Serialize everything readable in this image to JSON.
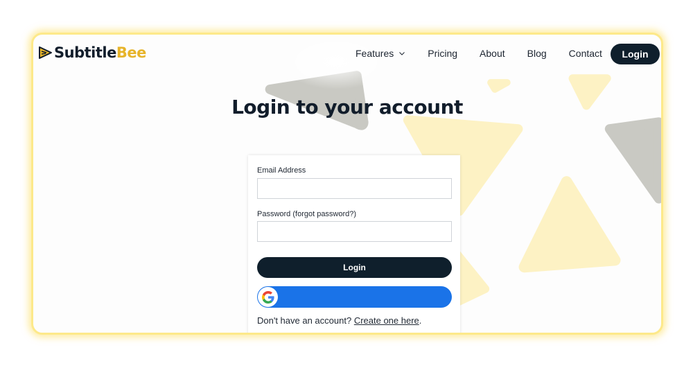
{
  "brand": {
    "name_part1": "Subtitle",
    "name_part2": "Bee",
    "accent_color": "#e7b42a",
    "dark_color": "#111d2b"
  },
  "nav": {
    "items": [
      {
        "label": "Features",
        "has_dropdown": true
      },
      {
        "label": "Pricing"
      },
      {
        "label": "About"
      },
      {
        "label": "Blog"
      },
      {
        "label": "Contact"
      }
    ],
    "login_label": "Login"
  },
  "page": {
    "title": "Login to your account"
  },
  "form": {
    "email_label": "Email Address",
    "email_value": "",
    "password_label": "Password (forgot password?)",
    "password_value": "",
    "login_button": "Login",
    "google_button_color": "#1a73e8",
    "google_icon": "google-g-icon",
    "signup_prefix": "Don't have an account? ",
    "signup_link": "Create one here",
    "signup_suffix": "."
  }
}
